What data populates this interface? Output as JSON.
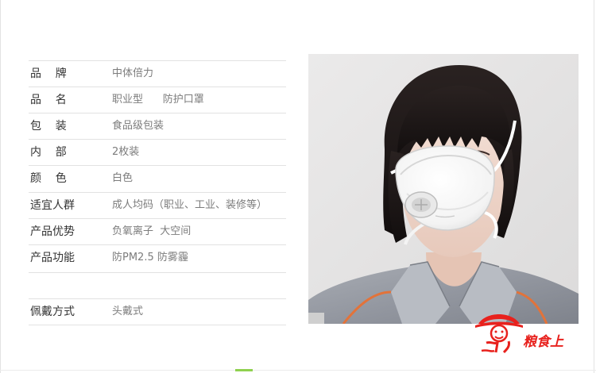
{
  "specs": [
    {
      "label": "品    牌",
      "value": "中体倍力"
    },
    {
      "label": "品    名",
      "value": "职业型      防护口罩"
    },
    {
      "label": "包    装",
      "value": "食品级包装"
    },
    {
      "label": "内    部",
      "value": "2枚装"
    },
    {
      "label": "颜    色",
      "value": "白色"
    },
    {
      "label": "适宜人群",
      "value": "成人均码（职业、工业、装修等）"
    },
    {
      "label": "产品优势",
      "value": "负氧离子  大空间"
    },
    {
      "label": "产品功能",
      "value": "防PM2.5 防雾霾"
    }
  ],
  "wear": {
    "label": "佩戴方式",
    "value": "头戴式"
  },
  "watermark": {
    "text": "粮食上"
  },
  "colors": {
    "label": "#333333",
    "value": "#7c7c7c",
    "divider": "#e2e2e2",
    "watermark_red": "#e8211d",
    "accent_green": "#8fd14f"
  },
  "icons": {
    "product_photo": "woman-wearing-mask-photo",
    "watermark_logo": "straw-hat-figure-logo"
  }
}
